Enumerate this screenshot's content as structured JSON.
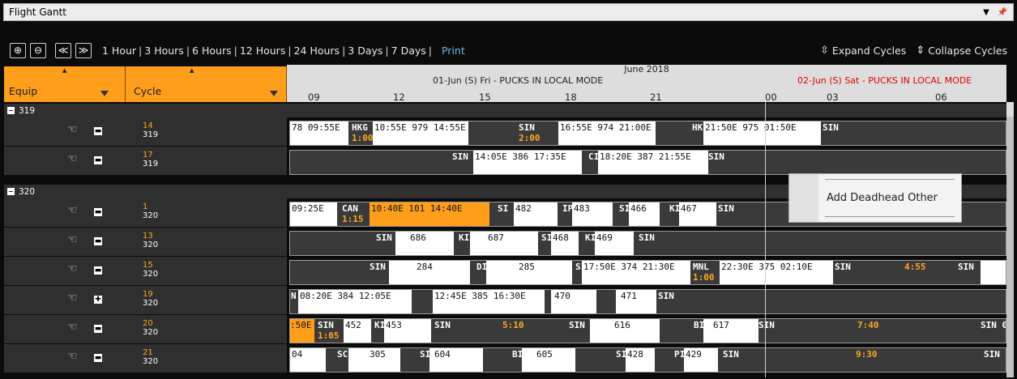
{
  "window": {
    "title": "Flight Gantt"
  },
  "toolbar": {
    "ranges": [
      "1 Hour",
      "3 Hours",
      "6 Hours",
      "12 Hours",
      "24 Hours",
      "3 Days",
      "7 Days"
    ],
    "print": "Print",
    "expand": "Expand Cycles",
    "collapse": "Collapse Cycles"
  },
  "columns": {
    "equip": "Equip",
    "cycle": "Cycle"
  },
  "timeline": {
    "month": "June 2018",
    "day1": "01-Jun (S) Fri - PUCKS IN LOCAL MODE",
    "day2": "02-Jun (S) Sat - PUCKS IN LOCAL MODE",
    "hours": [
      "09",
      "12",
      "15",
      "18",
      "21",
      "00",
      "03",
      "06"
    ]
  },
  "groups": [
    {
      "label": "319"
    },
    {
      "label": "320"
    }
  ],
  "rows": [
    {
      "cycle": "14",
      "equip": "319"
    },
    {
      "cycle": "17",
      "equip": "319"
    },
    {
      "cycle": "1",
      "equip": "320"
    },
    {
      "cycle": "13",
      "equip": "320"
    },
    {
      "cycle": "15",
      "equip": "320"
    },
    {
      "cycle": "19",
      "equip": "320"
    },
    {
      "cycle": "20",
      "equip": "320"
    },
    {
      "cycle": "21",
      "equip": "320"
    }
  ],
  "gantt": {
    "r0": {
      "a": "78  09:55E",
      "b": "HKG",
      "b2": "1:00",
      "c": "10:55E  979  14:55E",
      "d": "SIN",
      "d2": "2:00",
      "e": "16:55E  974  21:00E",
      "f": "HK",
      "g": "21:50E  975  01:50E",
      "h": "SIN"
    },
    "r1": {
      "a": "SIN",
      "b": "14:05E 386 17:35E",
      "c": "CI",
      "d": "18:20E 387  21:55E",
      "e": "SIN"
    },
    "r2": {
      "a": "09:25E",
      "b": "CAN",
      "b2": "1:15",
      "c": "10:40E  101  14:40E",
      "d": "SI",
      "e": "482",
      "f": "IP",
      "g": "483",
      "h": "SI",
      "i": "466",
      "j": "KI",
      "k": "467",
      "l": "SIN"
    },
    "r3": {
      "a": "SIN",
      "b": "686",
      "c": "KI",
      "d": "687",
      "e": "SI",
      "f": "468",
      "g": "KI",
      "h": "469",
      "i": "SIN"
    },
    "r4": {
      "a": "SIN",
      "b": "284",
      "c": "DI",
      "d": "285",
      "e": "SI",
      "f": "17:50E  374  21:30E",
      "g": "MNL",
      "g2": "1:00",
      "h": "22:30E  375  02:10E",
      "i": "SIN",
      "j": "4:55",
      "k": "SIN"
    },
    "r5": {
      "a": "N",
      "b": "08:20E  384  12:05E",
      "c": "12:45E  385  16:30E",
      "d": "470",
      "e": "471",
      "f": "SIN"
    },
    "r6": {
      "a": ":50E",
      "b": "SIN",
      "b2": "1:05",
      "c": "452",
      "d": "KI",
      "e": "453",
      "f": "SIN",
      "g": "5:10",
      "h": "SIN",
      "i": "616",
      "j": "BI",
      "k": "617",
      "l": "SIN",
      "m": "7:40",
      "n": "SIN 07:"
    },
    "r7": {
      "a": "04",
      "b": "SC",
      "c": "305",
      "d": "SI",
      "e": "604",
      "f": "BI",
      "g": "605",
      "h": "SI",
      "i": "428",
      "j": "PI",
      "k": "429",
      "l": "SIN",
      "m": "9:30",
      "n": "SIN"
    }
  },
  "popup": {
    "label": "Add Deadhead Other"
  }
}
